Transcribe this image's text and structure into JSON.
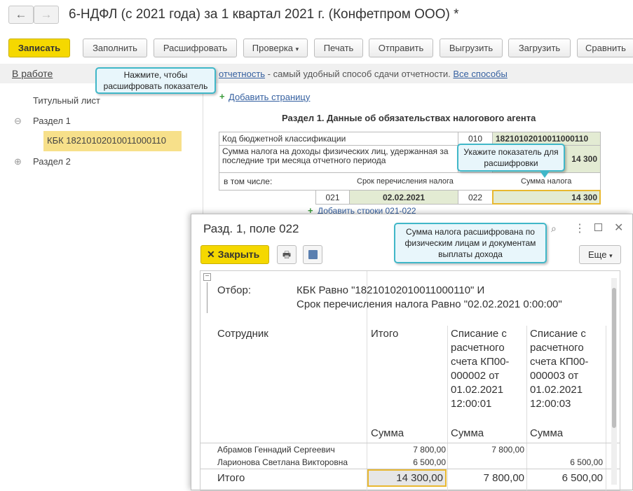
{
  "window": {
    "title": "6-НДФЛ (с 2021 года) за 1 квартал 2021 г. (Конфетпром ООО) *",
    "back_icon": "←",
    "forward_icon": "→"
  },
  "toolbar": {
    "save": "Записать",
    "fill": "Заполнить",
    "decode": "Расшифровать",
    "check": "Проверка",
    "print": "Печать",
    "send": "Отправить",
    "export": "Выгрузить",
    "import": "Загрузить",
    "compare": "Сравнить"
  },
  "infobar": {
    "status": "В работе",
    "link1": "отчетность",
    "text": " - самый удобный способ сдачи отчетности. ",
    "link2": "Все способы"
  },
  "callouts": {
    "decode_hint": "Нажмите, чтобы расшифровать показатель",
    "field_hint": "Укажите показатель для расшифровки",
    "result_hint": "Сумма налога расшифрована по физическим лицам и документам выплаты дохода"
  },
  "sidebar": {
    "items": [
      {
        "label": "Титульный лист"
      },
      {
        "label": "Раздел 1",
        "toggle": "⊖"
      },
      {
        "label": "КБК 18210102010011000110"
      },
      {
        "label": "Раздел 2",
        "toggle": "⊕"
      }
    ]
  },
  "form": {
    "add_page": "Добавить страницу",
    "section_title": "Раздел 1. Данные об обязательствах налогового агента",
    "kbk_label": "Код бюджетной классификации",
    "kbk_code": "010",
    "kbk_value": "18210102010011000110",
    "tax_label": "Сумма налога на доходы физических лиц, удержанная за последние три месяца отчетного периода",
    "tax_value": "14 300",
    "including": "в том числе:",
    "date_header": "Срок перечисления налога",
    "sum_header": "Сумма налога",
    "code021": "021",
    "date_value": "02.02.2021",
    "code022": "022",
    "sum_value": "14 300",
    "add_rows": "Добавить строки 021-022"
  },
  "dialog": {
    "title": "Разд. 1, поле 022",
    "close_btn": "Закрыть",
    "more_btn": "Еще",
    "filter_label": "Отбор:",
    "filter_line1": "КБК Равно \"18210102010011000110\" И",
    "filter_line2": "Срок перечисления налога Равно \"02.02.2021 0:00:00\"",
    "col_employee": "Сотрудник",
    "col_total": "Итого",
    "col_doc1": "Списание с расчетного счета КП00-000002 от 01.02.2021 12:00:01",
    "col_doc2": "Списание с расчетного счета КП00-000003 от 01.02.2021 12:00:03",
    "sum_label": "Сумма",
    "rows": [
      {
        "name": "Абрамов Геннадий Сергеевич",
        "total": "7 800,00",
        "doc1": "7 800,00",
        "doc2": ""
      },
      {
        "name": "Ларионова Светлана Викторовна",
        "total": "6 500,00",
        "doc1": "",
        "doc2": "6 500,00"
      }
    ],
    "total_label": "Итого",
    "total_sum": "14 300,00",
    "total_doc1": "7 800,00",
    "total_doc2": "6 500,00"
  }
}
